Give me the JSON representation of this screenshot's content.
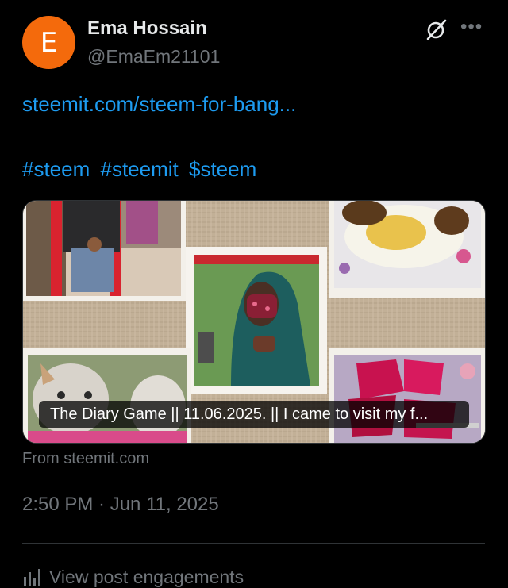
{
  "author": {
    "avatar_letter": "E",
    "avatar_color": "#f46a0c",
    "name": "Ema Hossain",
    "handle": "@EmaEm21101"
  },
  "header_actions": {
    "grok_icon": "grok-slash-icon",
    "more_label": "•••"
  },
  "post": {
    "link_text": "steemit.com/steem-for-bang...",
    "hashtags": [
      "#steem",
      "#steemit",
      "$steem"
    ]
  },
  "card": {
    "title": "The Diary Game || 11.06.2025. || I came to visit my f...",
    "source": "From steemit.com"
  },
  "meta": {
    "timestamp": "2:50 PM · Jun 11, 2025"
  },
  "engagements": {
    "label": "View post engagements"
  },
  "colors": {
    "accent": "#1d9bf0",
    "muted": "#71767b",
    "text": "#e7e9ea",
    "background": "#000000"
  }
}
